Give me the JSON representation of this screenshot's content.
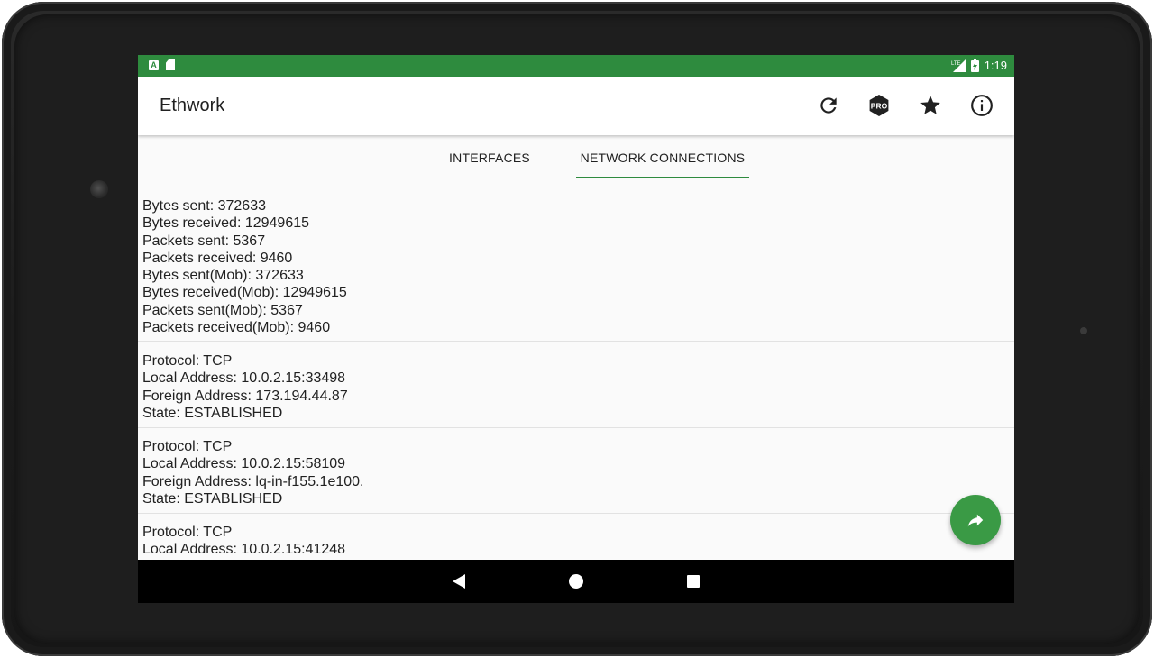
{
  "status_bar": {
    "time": "1:19",
    "notification_icons": [
      "a-notification-icon",
      "sd-card-icon"
    ],
    "system_icons": [
      "lte-signal-icon",
      "battery-charging-icon"
    ],
    "color": "#2e8b3e"
  },
  "app_bar": {
    "title": "Ethwork",
    "actions": [
      {
        "name": "refresh-icon"
      },
      {
        "name": "pro-badge-icon",
        "label": "PRO"
      },
      {
        "name": "star-icon"
      },
      {
        "name": "info-icon"
      }
    ]
  },
  "tabs": [
    {
      "label": "INTERFACES",
      "selected": false
    },
    {
      "label": "NETWORK CONNECTIONS",
      "selected": true
    }
  ],
  "stats": {
    "lines": [
      "Bytes sent: 372633",
      "Bytes received: 12949615",
      "Packets sent: 5367",
      "Packets received: 9460",
      "Bytes sent(Mob): 372633",
      "Bytes received(Mob): 12949615",
      "Packets sent(Mob): 5367",
      "Packets received(Mob): 9460"
    ]
  },
  "connections": [
    {
      "protocol": "Protocol: TCP",
      "local": "Local Address: 10.0.2.15:33498",
      "foreign": "Foreign Address: 173.194.44.87",
      "state": "State: ESTABLISHED"
    },
    {
      "protocol": "Protocol: TCP",
      "local": "Local Address: 10.0.2.15:58109",
      "foreign": "Foreign Address: lq-in-f155.1e100.",
      "state": "State: ESTABLISHED"
    },
    {
      "protocol": "Protocol: TCP",
      "local": "Local Address: 10.0.2.15:41248"
    }
  ],
  "fab": {
    "icon": "share-icon",
    "color": "#3a9a45"
  },
  "nav_bar": {
    "buttons": [
      "back-icon",
      "home-icon",
      "recents-icon"
    ]
  }
}
